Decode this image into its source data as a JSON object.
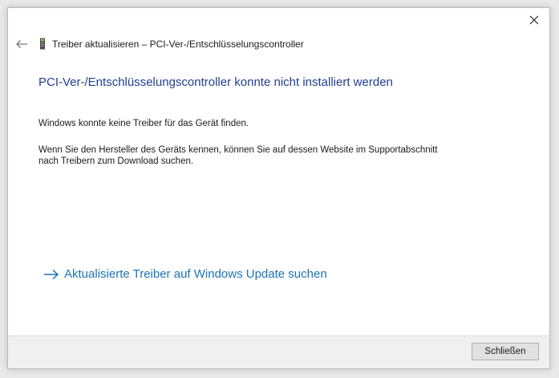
{
  "window": {
    "title": "Treiber aktualisieren – PCI-Ver-/Entschlüsselungscontroller"
  },
  "icons": {
    "back": "back-arrow-icon",
    "device": "device-icon",
    "close": "close-icon",
    "link_arrow": "arrow-right-icon"
  },
  "content": {
    "heading": "PCI-Ver-/Entschlüsselungscontroller konnte nicht installiert werden",
    "message1": "Windows konnte keine Treiber für das Gerät finden.",
    "message2_line1": "Wenn Sie den Hersteller des Geräts kennen, können Sie auf dessen Website im Supportabschnitt",
    "message2_line2": "nach Treibern zum Download suchen.",
    "update_link": "Aktualisierte Treiber auf Windows Update suchen"
  },
  "footer": {
    "close_label": "Schließen"
  },
  "colors": {
    "heading": "#1f3f8f",
    "link": "#1d73b9",
    "footer_bg": "#f0f0f0"
  }
}
